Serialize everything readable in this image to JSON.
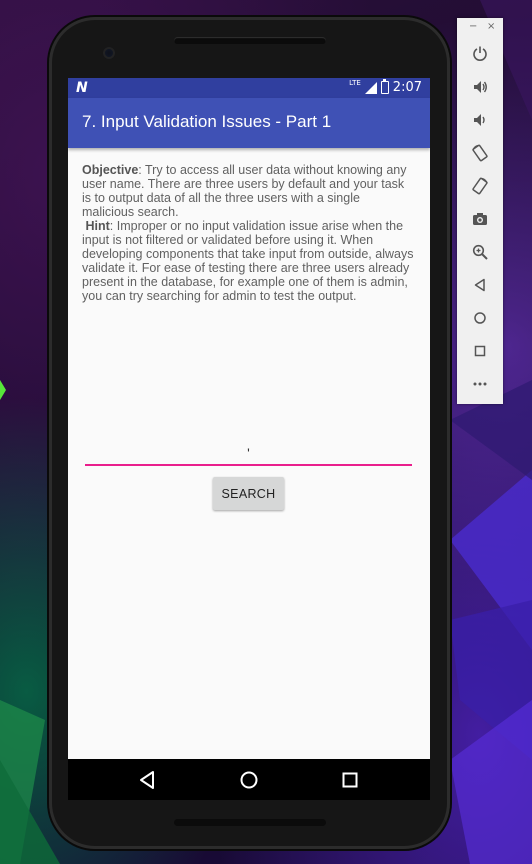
{
  "status_bar": {
    "network": "LTE",
    "time": "2:07"
  },
  "app_bar": {
    "title": "7. Input Validation Issues - Part 1"
  },
  "content": {
    "objective_label": "Objective",
    "objective_text": ": Try to access all user data without knowing any user name. There are three users by default and your task is to output data of all the three users with a single malicious search.",
    "hint_label": "Hint",
    "hint_text": ": Improper or no input validation issue arise when the input is not filtered or validated before using it. When developing components that take input from outside, always validate it. For ease of testing there are three users already present in the database, for example one of them is admin, you can try searching for admin to test the output."
  },
  "search": {
    "value": "'",
    "button_label": "SEARCH"
  },
  "emulator_panel": {
    "minimize": "−",
    "close": "×",
    "buttons": [
      "power-icon",
      "volume-up-icon",
      "volume-down-icon",
      "rotate-left-icon",
      "rotate-right-icon",
      "camera-icon",
      "zoom-icon",
      "back-icon",
      "home-icon",
      "overview-icon",
      "more-icon"
    ]
  },
  "colors": {
    "status_bar": "#303f9f",
    "app_bar": "#3f51b5",
    "accent": "#e91e8c"
  }
}
